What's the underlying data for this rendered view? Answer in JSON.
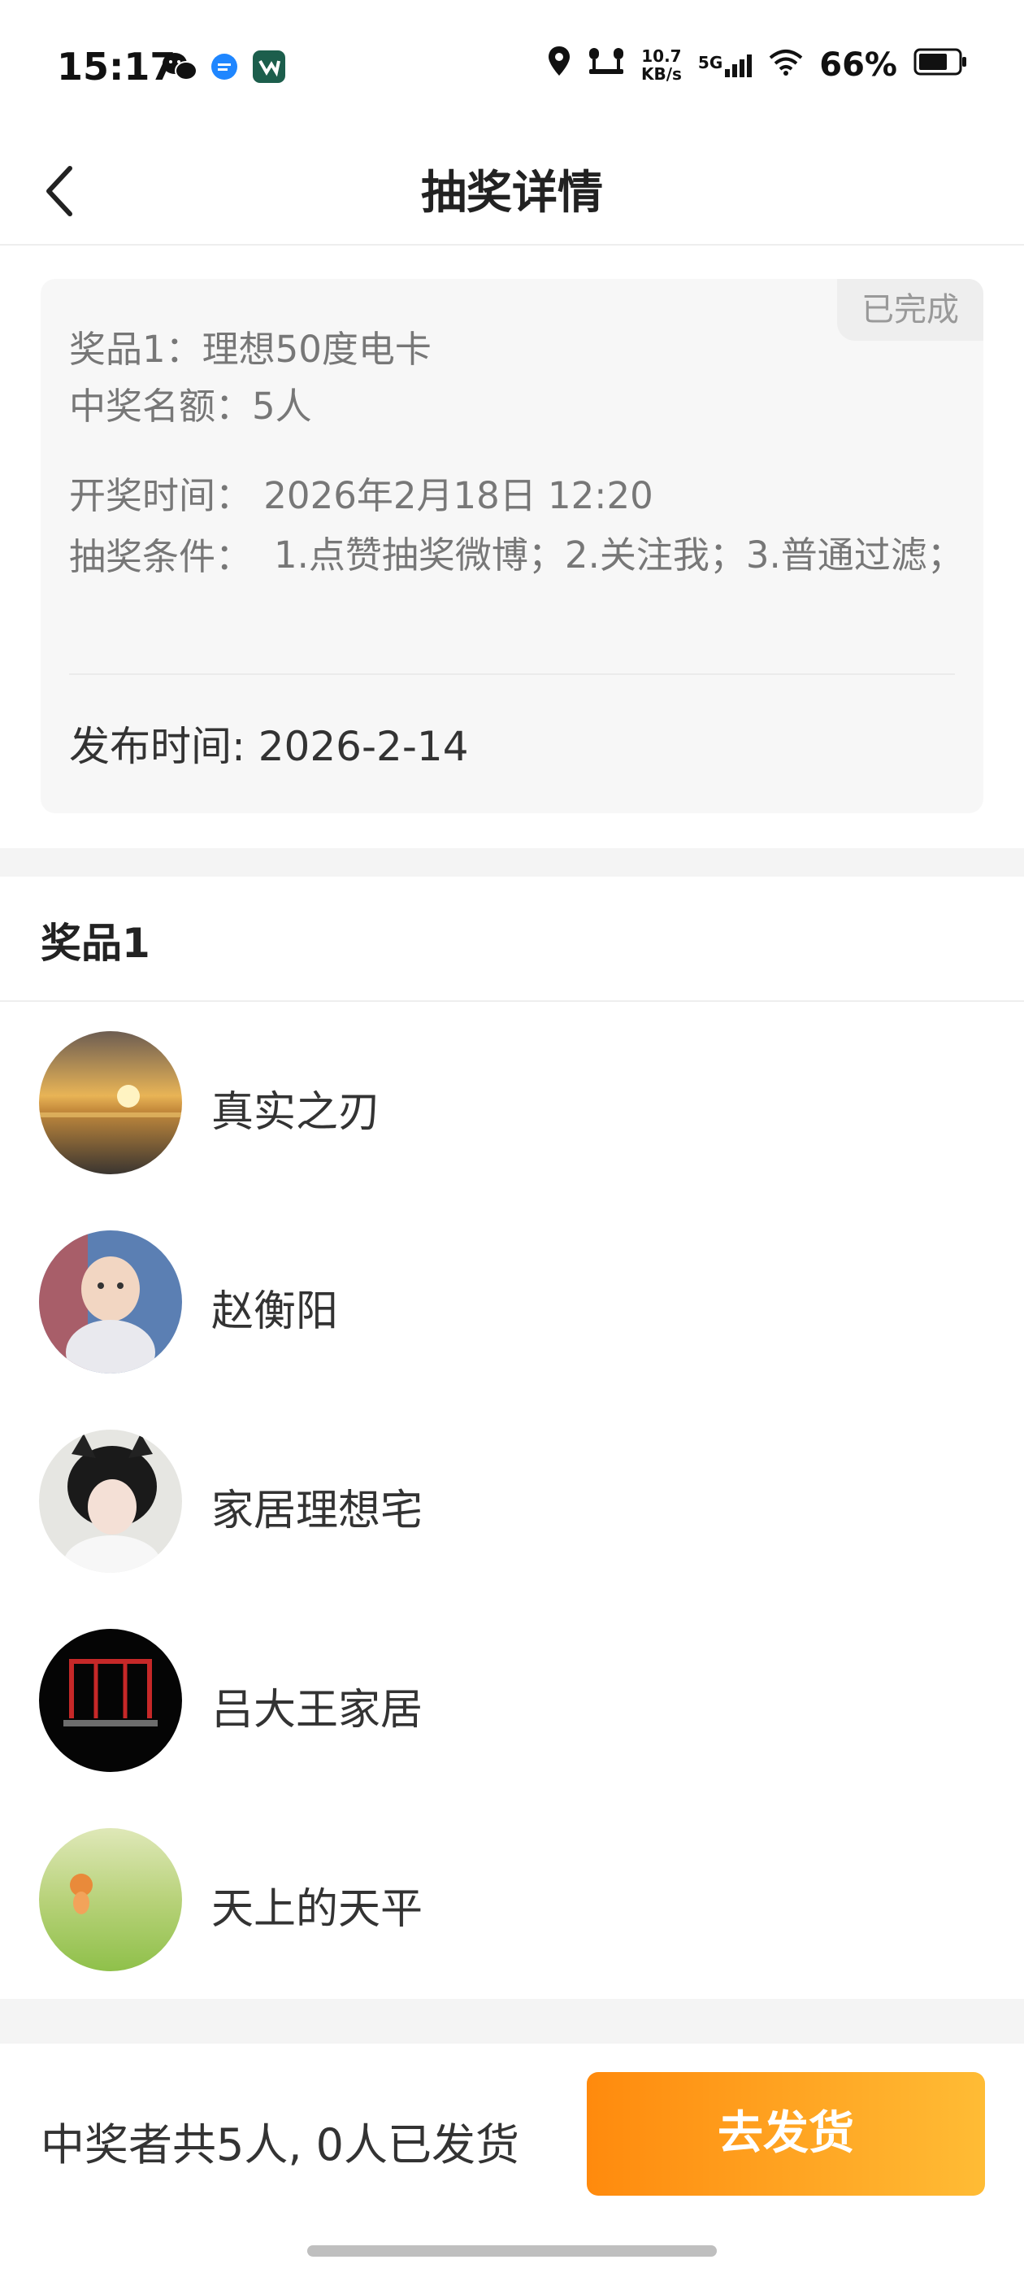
{
  "status_bar": {
    "time": "15:17",
    "left_icons": [
      "wechat-icon",
      "chat-bubble-icon",
      "app-icon"
    ],
    "net_speed_value": "10.7",
    "net_speed_unit": "KB/s",
    "network": "5G",
    "battery": "66%"
  },
  "nav": {
    "title": "抽奖详情"
  },
  "card": {
    "status": "已完成",
    "prize": "奖品1：理想50度电卡",
    "quota": "中奖名额：5人",
    "draw_time": "开奖时间： 2026年2月18日 12:20",
    "conditions_label": "抽奖条件：",
    "conditions": "1.点赞抽奖微博；2.关注我；3.普通过滤；",
    "publish_time": "发布时间: 2026-2-14"
  },
  "prize_section": {
    "title": "奖品1",
    "winners": [
      {
        "name": "真实之刃"
      },
      {
        "name": "赵衡阳"
      },
      {
        "name": "家居理想宅"
      },
      {
        "name": "吕大王家居"
      },
      {
        "name": "天上的天平"
      }
    ]
  },
  "bottom": {
    "summary": "中奖者共5人, 0人已发货",
    "ship_button": "去发货"
  },
  "colors": {
    "accent_start": "#ff8a0d",
    "accent_end": "#ffbc35"
  }
}
